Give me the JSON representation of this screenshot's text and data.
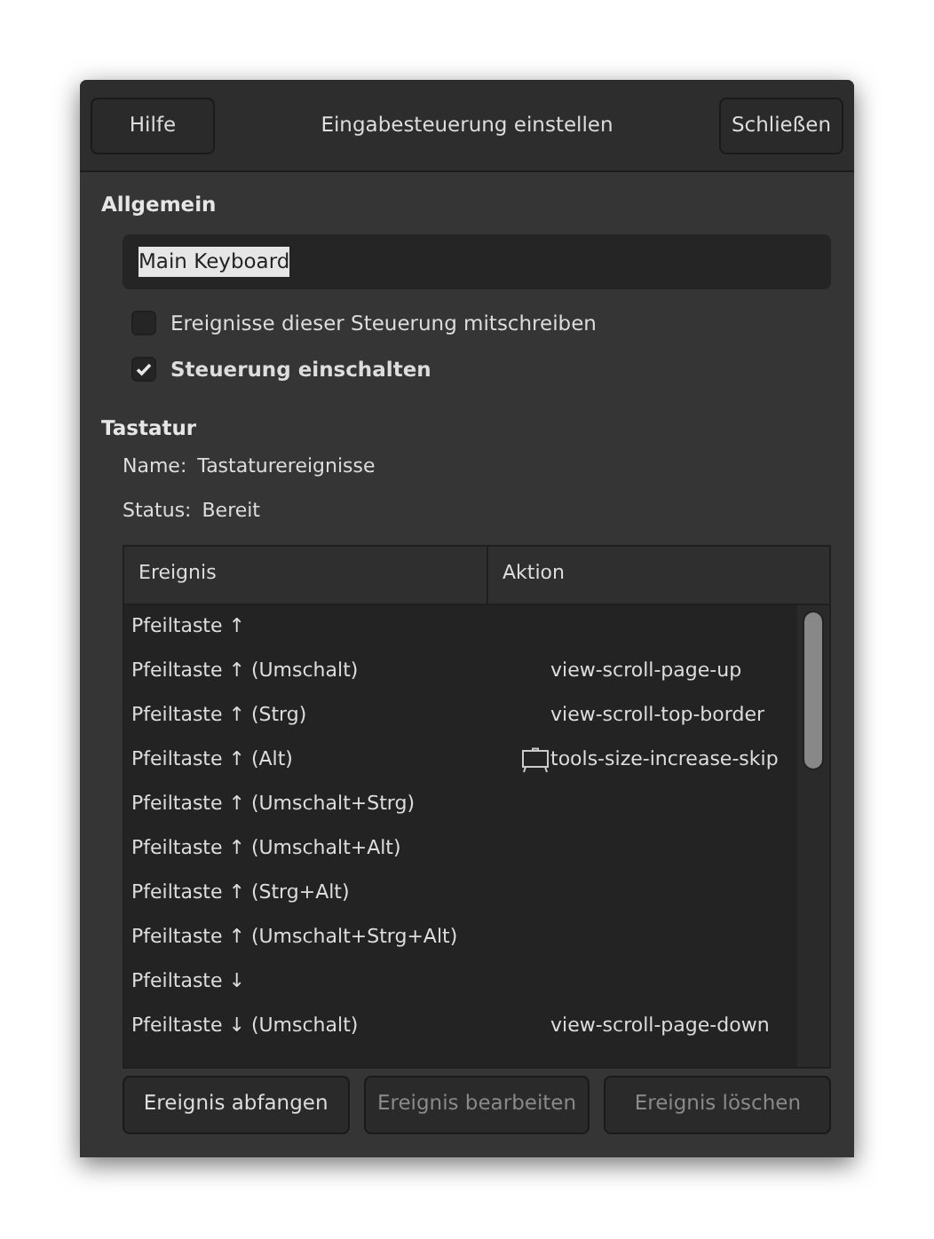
{
  "header": {
    "help_button": "Hilfe",
    "title": "Eingabesteuerung einstellen",
    "close_button": "Schließen"
  },
  "general": {
    "heading": "Allgemein",
    "name_field": {
      "value": "Main Keyboard",
      "text_selected": true
    },
    "checkboxes": [
      {
        "label": "Ereignisse dieser Steuerung mitschreiben",
        "checked": false
      },
      {
        "label": "Steuerung einschalten",
        "checked": true
      }
    ]
  },
  "keyboard": {
    "heading": "Tastatur",
    "info": [
      {
        "label": "Name:",
        "value": "Tastaturereignisse"
      },
      {
        "label": "Status:",
        "value": "Bereit"
      }
    ]
  },
  "table": {
    "columns": [
      "Ereignis",
      "Aktion"
    ],
    "rows": [
      {
        "event": "Pfeiltaste ↑",
        "action": "",
        "action_icon": false
      },
      {
        "event": "Pfeiltaste ↑ (Umschalt)",
        "action": "view-scroll-page-up",
        "action_icon": false
      },
      {
        "event": "Pfeiltaste ↑ (Strg)",
        "action": "view-scroll-top-border",
        "action_icon": false
      },
      {
        "event": "Pfeiltaste ↑ (Alt)",
        "action": "tools-size-increase-skip",
        "action_icon": true
      },
      {
        "event": "Pfeiltaste ↑ (Umschalt+Strg)",
        "action": "",
        "action_icon": false
      },
      {
        "event": "Pfeiltaste ↑ (Umschalt+Alt)",
        "action": "",
        "action_icon": false
      },
      {
        "event": "Pfeiltaste ↑ (Strg+Alt)",
        "action": "",
        "action_icon": false
      },
      {
        "event": "Pfeiltaste ↑ (Umschalt+Strg+Alt)",
        "action": "",
        "action_icon": false
      },
      {
        "event": "Pfeiltaste ↓",
        "action": "",
        "action_icon": false
      },
      {
        "event": "Pfeiltaste ↓ (Umschalt)",
        "action": "view-scroll-page-down",
        "action_icon": false
      }
    ]
  },
  "buttons": [
    {
      "label": "Ereignis abfangen",
      "disabled": false
    },
    {
      "label": "Ereignis bearbeiten",
      "disabled": true
    },
    {
      "label": "Ereignis löschen",
      "disabled": true
    }
  ]
}
